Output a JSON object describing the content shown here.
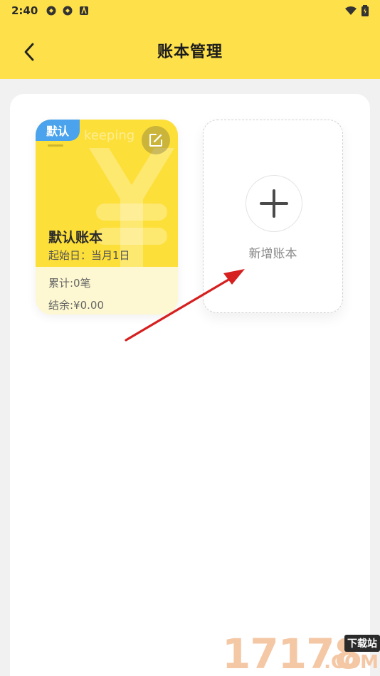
{
  "status_bar": {
    "time": "2:40",
    "left_icons": [
      "notification-icon",
      "notification-icon",
      "app-icon"
    ],
    "right_icons": [
      "wifi-icon",
      "battery-icon"
    ]
  },
  "header": {
    "title": "账本管理",
    "back_icon": "chevron-left-icon",
    "background_color": "#fde04a"
  },
  "books": [
    {
      "badge": "默认",
      "watermark": "keeping",
      "name": "默认账本",
      "start": "起始日：当月1日",
      "count": "累计:0笔",
      "balance": "结余:¥0.00",
      "edit_icon": "edit-icon",
      "color": "#fddf3a"
    }
  ],
  "add_book": {
    "label": "新增账本",
    "icon": "plus-icon"
  },
  "annotation": {
    "type": "arrow",
    "color": "#d61f1f"
  },
  "watermark": {
    "number": "17178",
    "tag": "下载站",
    "suffix": ".COM"
  }
}
